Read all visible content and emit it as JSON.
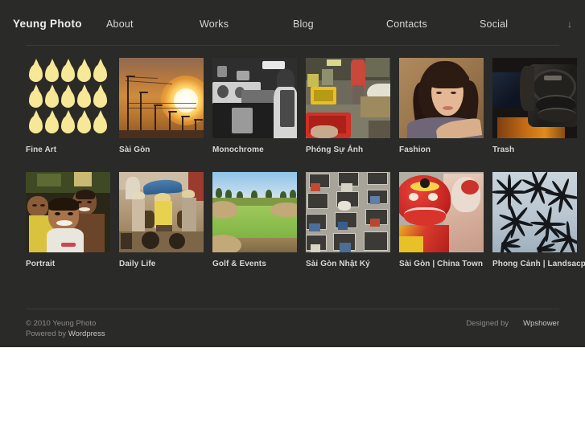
{
  "site": {
    "brand": "Yeung Photo",
    "background_color": "#2a2a28",
    "text_color": "#d8d6d2"
  },
  "nav": {
    "items": [
      {
        "label": "Yeung Photo",
        "type": "brand"
      },
      {
        "label": "About",
        "type": "link"
      },
      {
        "label": "Works",
        "type": "link"
      },
      {
        "label": "Blog",
        "type": "link"
      },
      {
        "label": "Contacts",
        "type": "link"
      },
      {
        "label": "Social",
        "type": "link"
      }
    ],
    "arrow_icon": "↓"
  },
  "gallery": {
    "row1": [
      {
        "caption": "Fine Art"
      },
      {
        "caption": "Sài Gòn"
      },
      {
        "caption": "Monochrome"
      },
      {
        "caption": "Phóng Sự Ảnh"
      },
      {
        "caption": "Fashion"
      },
      {
        "caption": "Trash"
      }
    ],
    "row2": [
      {
        "caption": "Portrait"
      },
      {
        "caption": "Daily Life"
      },
      {
        "caption": "Golf & Events"
      },
      {
        "caption": "Sài Gòn Nhật Ký"
      },
      {
        "caption": "Sài Gòn | China Town"
      },
      {
        "caption": "Phong Cảnh | Landsacpe"
      }
    ]
  },
  "footer": {
    "copyright": "© 2010 Yeung Photo",
    "powered_prefix": "Powered by ",
    "powered_link": "Wordpress",
    "designed_prefix": "Designed by",
    "designed_link": "Wpshower"
  }
}
